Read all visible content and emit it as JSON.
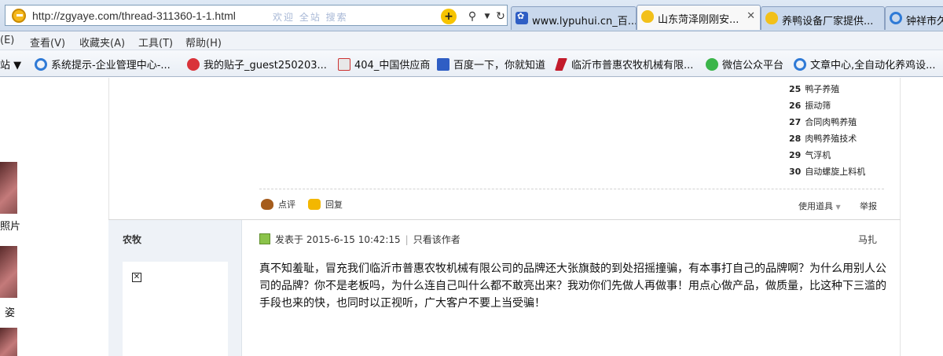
{
  "address_bar": {
    "url": "http://zgyaye.com/thread-311360-1-1.html",
    "ghost_text": "欢迎 全站 搜索"
  },
  "tabs": [
    {
      "label": "www.lypuhui.cn_百...",
      "icon": "paw-icon",
      "active": false
    },
    {
      "label": "山东菏泽刚刚安...",
      "icon": "duck-icon",
      "active": true
    },
    {
      "label": "养鸭设备厂家提供...",
      "icon": "duck-icon",
      "active": false
    },
    {
      "label": "钟祥市久",
      "icon": "ie-icon",
      "active": false
    }
  ],
  "menu": [
    {
      "label": "(E)"
    },
    {
      "label": "查看(V)"
    },
    {
      "label": "收藏夹(A)"
    },
    {
      "label": "工具(T)"
    },
    {
      "label": "帮助(H)"
    }
  ],
  "favorites": [
    {
      "label": "站 ▼",
      "icon": "none"
    },
    {
      "label": "系统提示-企业管理中心-...",
      "icon": "ie-icon"
    },
    {
      "label": "我的贴子_guest250203...",
      "icon": "tieba-icon"
    },
    {
      "label": "404_中国供应商",
      "icon": "404-icon"
    },
    {
      "label": "百度一下，你就知道",
      "icon": "baidu-paw-icon"
    },
    {
      "label": "临沂市普惠农牧机械有限...",
      "icon": "red-flag-icon"
    },
    {
      "label": "微信公众平台",
      "icon": "wechat-icon"
    },
    {
      "label": "文章中心,全自动化养鸡设...",
      "icon": "ie-icon"
    }
  ],
  "left_strip": {
    "label_1": "照片",
    "label_2": "姿"
  },
  "related_list": [
    {
      "num": "25",
      "text": "鸭子养殖"
    },
    {
      "num": "26",
      "text": "振动筛"
    },
    {
      "num": "27",
      "text": "合同肉鸭养殖"
    },
    {
      "num": "28",
      "text": "肉鸭养殖技术"
    },
    {
      "num": "29",
      "text": "气浮机"
    },
    {
      "num": "30",
      "text": "自动螺旋上料机"
    }
  ],
  "actions": {
    "comment": "点评",
    "reply": "回复",
    "tools": "使用道具",
    "report": "举报"
  },
  "post": {
    "author": "农牧",
    "posted": "发表于 2015-6-15 10:42:15",
    "only_author": "只看该作者",
    "floor": "马扎",
    "content": "真不知羞耻，冒充我们临沂市普惠农牧机械有限公司的品牌还大张旗鼓的到处招摇撞骗，有本事打自己的品牌啊？为什么用别人公司的品牌？你不是老板吗，为什么连自己叫什么都不敢亮出来？我劝你们先做人再做事！用点心做产品，做质量，比这种下三滥的手段也来的快，也同时以正视听，广大客户不要上当受骗！"
  }
}
